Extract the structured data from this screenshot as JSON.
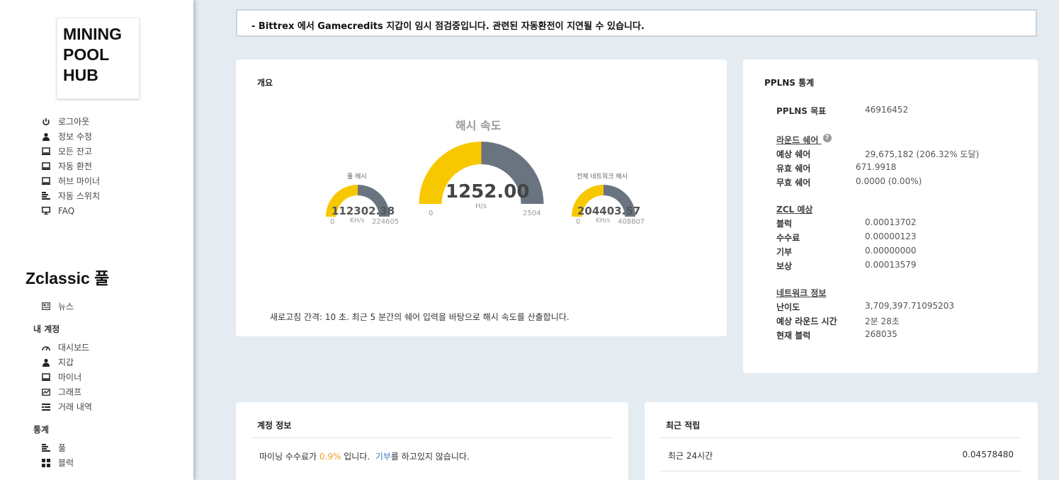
{
  "logo": {
    "lines": [
      "MINING",
      "POOL",
      "HUB"
    ]
  },
  "top_nav": [
    {
      "label": "로그아웃",
      "icon": "power-icon"
    },
    {
      "label": "정보 수정",
      "icon": "user-icon"
    },
    {
      "label": "모든 잔고",
      "icon": "monitor-icon"
    },
    {
      "label": "자동 환전",
      "icon": "monitor-icon"
    },
    {
      "label": "허브 마이너",
      "icon": "monitor-icon"
    },
    {
      "label": "자동 스위치",
      "icon": "bars-icon"
    },
    {
      "label": "FAQ",
      "icon": "desktop-icon"
    }
  ],
  "pool_title": "Zclassic 풀",
  "news": {
    "label": "뉴스",
    "icon": "newspaper-icon"
  },
  "account_section": {
    "title": "내 계정",
    "items": [
      {
        "label": "대시보드",
        "icon": "dashboard-icon"
      },
      {
        "label": "지갑",
        "icon": "user-icon"
      },
      {
        "label": "마이너",
        "icon": "monitor-icon"
      },
      {
        "label": "그래프",
        "icon": "chart-icon"
      },
      {
        "label": "거래 내역",
        "icon": "list-icon"
      }
    ]
  },
  "stats_section": {
    "title": "통계",
    "items": [
      {
        "label": "풀",
        "icon": "bars-icon"
      },
      {
        "label": "블럭",
        "icon": "grid-icon"
      }
    ]
  },
  "banner": {
    "text": "- Bittrex 에서 Gamecredits 지갑이 임시 점검중입니다. 관련된 자동환전이 지연될 수 있습니다."
  },
  "overview": {
    "title": "개요",
    "main_gauge": {
      "title": "해시 속도",
      "value": "1252.00",
      "number": 1252.0,
      "unit": "H/s",
      "min": "0",
      "max": "2504",
      "max_num": 2504
    },
    "pool_gauge": {
      "title": "풀 해시",
      "value": "112302.38",
      "number": 112302.38,
      "unit": "KH/s",
      "min": "0",
      "max": "224605",
      "max_num": 224605
    },
    "net_gauge": {
      "title": "전체 네트워크 해시",
      "value": "204403.57",
      "number": 204403.57,
      "unit": "KH/s",
      "min": "0",
      "max": "408807",
      "max_num": 408807
    },
    "refresh_note": "새로고침 간격: 10 초. 최근 5 분간의 쉐어 입력을 바탕으로 해시 속도를 산출합니다.",
    "colors": {
      "fill": "#f7c800",
      "track": "#6a7481"
    }
  },
  "pplns": {
    "title": "PPLNS 통계",
    "target_label": "PPLNS 목표",
    "target_value": "46916452",
    "round_head": "라운드 쉐어",
    "round_rows": [
      {
        "k": "예상 쉐어",
        "v": "29,675,182 (206.32% 도달)"
      },
      {
        "k": "유효 쉐어",
        "v": "671.9918"
      },
      {
        "k": "무효 쉐어",
        "v": "0.0000 (0.00%)"
      }
    ],
    "zcl_head": "ZCL 예상",
    "zcl_rows": [
      {
        "k": "블럭",
        "v": "0.00013702"
      },
      {
        "k": "수수료",
        "v": "0.00000123"
      },
      {
        "k": "기부",
        "v": "0.00000000"
      },
      {
        "k": "보상",
        "v": "0.00013579"
      }
    ],
    "net_head": "네트워크 정보",
    "net_rows": [
      {
        "k": "난이도",
        "v": "3,709,397.71095203"
      },
      {
        "k": "예상 라운드 시간",
        "v": "2분 28초"
      },
      {
        "k": "현재 블럭",
        "v": "268035"
      }
    ]
  },
  "account_info": {
    "title": "계정 정보",
    "fee_prefix": "마이닝 수수료가 ",
    "fee_value": "0.9%",
    "fee_suffix": " 입니다.  ",
    "donate_link": "기부",
    "donate_suffix": "를 하고있지 않습니다."
  },
  "recent_credits": {
    "title": "최근 적립",
    "row_label": "최근 24시간",
    "row_value": "0.04578480"
  }
}
